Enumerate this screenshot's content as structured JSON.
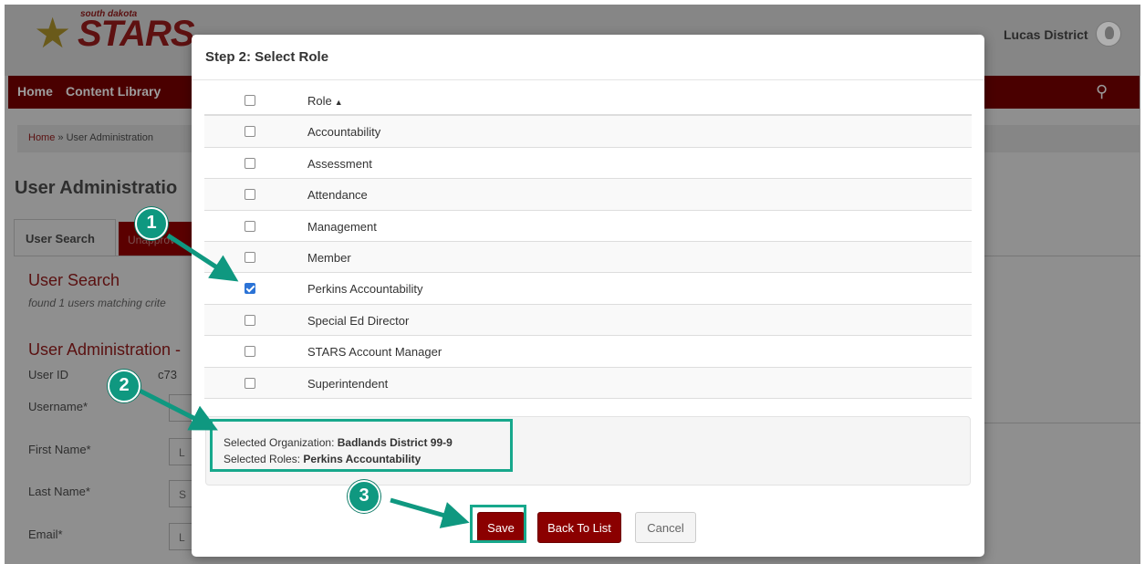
{
  "header": {
    "logo_small": "south dakota",
    "logo": "STARS",
    "user_name": "Lucas District"
  },
  "nav": {
    "items": [
      "Home",
      "Content Library"
    ]
  },
  "breadcrumb": {
    "home": "Home",
    "sep": "»",
    "current": "User Administration"
  },
  "page": {
    "title": "User Administratio",
    "tabs": [
      "User Search",
      "Unapprov"
    ],
    "section_title": "User Search",
    "section_sub": "found 1 users matching crite",
    "section_title2": "User Administration -",
    "fields": [
      {
        "label": "User ID",
        "value": "c73"
      },
      {
        "label": "Username*",
        "value": ""
      },
      {
        "label": "First Name*",
        "value": "L"
      },
      {
        "label": "Last Name*",
        "value": "S"
      },
      {
        "label": "Email*",
        "value": "L"
      }
    ]
  },
  "modal": {
    "title": "Step 2: Select Role",
    "column_header": "Role",
    "roles": [
      {
        "label": "Accountability",
        "checked": false
      },
      {
        "label": "Assessment",
        "checked": false
      },
      {
        "label": "Attendance",
        "checked": false
      },
      {
        "label": "Management",
        "checked": false
      },
      {
        "label": "Member",
        "checked": false
      },
      {
        "label": "Perkins Accountability",
        "checked": true
      },
      {
        "label": "Special Ed Director",
        "checked": false
      },
      {
        "label": "STARS Account Manager",
        "checked": false
      },
      {
        "label": "Superintendent",
        "checked": false
      }
    ],
    "summary": {
      "org_label": "Selected Organization:",
      "org_value": "Badlands District 99-9",
      "roles_label": "Selected Roles:",
      "roles_value": "Perkins Accountability"
    },
    "buttons": {
      "save": "Save",
      "back": "Back To List",
      "cancel": "Cancel"
    }
  },
  "annotations": {
    "badges": [
      "1",
      "2",
      "3"
    ],
    "color": "#17a88c"
  }
}
